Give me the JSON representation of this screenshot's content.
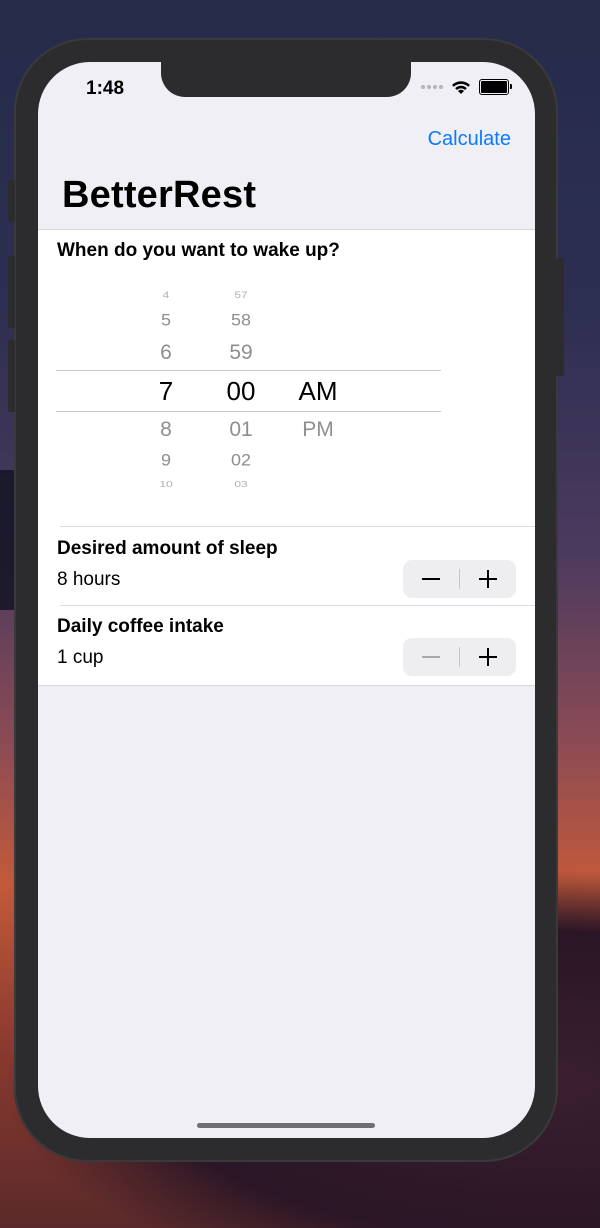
{
  "status_bar": {
    "time": "1:48"
  },
  "nav": {
    "action_label": "Calculate",
    "title": "BetterRest"
  },
  "wake": {
    "label": "When do you want to wake up?",
    "hours": [
      "4",
      "5",
      "6",
      "7",
      "8",
      "9",
      "10"
    ],
    "minutes": [
      "57",
      "58",
      "59",
      "00",
      "01",
      "02",
      "03"
    ],
    "periods": [
      "AM",
      "PM"
    ],
    "selected": {
      "hour": "7",
      "minute": "00",
      "period": "AM"
    }
  },
  "sleep": {
    "label": "Desired amount of sleep",
    "value": "8 hours"
  },
  "coffee": {
    "label": "Daily coffee intake",
    "value": "1 cup"
  },
  "colors": {
    "accent": "#0a7aff",
    "background": "#f0eff5"
  },
  "icons": {
    "minus": "minus-icon",
    "plus": "plus-icon",
    "wifi": "wifi-icon",
    "battery": "battery-icon"
  }
}
